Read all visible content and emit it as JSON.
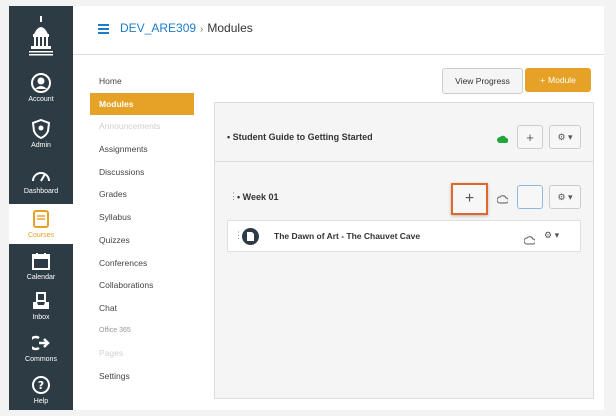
{
  "global_nav": {
    "items": [
      {
        "label": "Account",
        "icon": "account-icon"
      },
      {
        "label": "Admin",
        "icon": "shield-icon"
      },
      {
        "label": "Dashboard",
        "icon": "dashboard-icon"
      },
      {
        "label": "Courses",
        "icon": "book-icon",
        "active": true
      },
      {
        "label": "Calendar",
        "icon": "calendar-icon"
      },
      {
        "label": "Inbox",
        "icon": "inbox-icon"
      },
      {
        "label": "Commons",
        "icon": "commons-icon"
      },
      {
        "label": "Help",
        "icon": "help-icon"
      }
    ]
  },
  "breadcrumb": {
    "course": "DEV_ARE309",
    "separator": "›",
    "page": "Modules"
  },
  "course_nav": {
    "items": [
      {
        "label": "Home",
        "state": "normal"
      },
      {
        "label": "Modules",
        "state": "active"
      },
      {
        "label": "Announcements",
        "state": "faded"
      },
      {
        "label": "Assignments",
        "state": "normal"
      },
      {
        "label": "Discussions",
        "state": "normal"
      },
      {
        "label": "Grades",
        "state": "normal"
      },
      {
        "label": "Syllabus",
        "state": "normal"
      },
      {
        "label": "Quizzes",
        "state": "normal"
      },
      {
        "label": "Conferences",
        "state": "normal"
      },
      {
        "label": "Collaborations",
        "state": "normal"
      },
      {
        "label": "Chat",
        "state": "normal"
      },
      {
        "label": "Office 365",
        "state": "normal"
      },
      {
        "label": "Pages",
        "state": "faded"
      },
      {
        "label": "Settings",
        "state": "normal"
      }
    ]
  },
  "toolbar": {
    "view_progress": "View Progress",
    "add_module": "Module",
    "add_module_plus": "+"
  },
  "modules": [
    {
      "title": "Student Guide to Getting Started",
      "bullet": "•",
      "published": true
    },
    {
      "title": "Week 01",
      "bullet": "•",
      "published": false,
      "items": [
        {
          "title": "The Dawn of Art - The Chauvet Cave"
        }
      ]
    }
  ],
  "controls": {
    "add": "+",
    "gear": "⚙ ▾"
  },
  "colors": {
    "nav_bg": "#2d3b45",
    "accent": "#e6a227",
    "link": "#1d7cc9",
    "highlight": "#e0662b",
    "published": "#22a63b"
  }
}
